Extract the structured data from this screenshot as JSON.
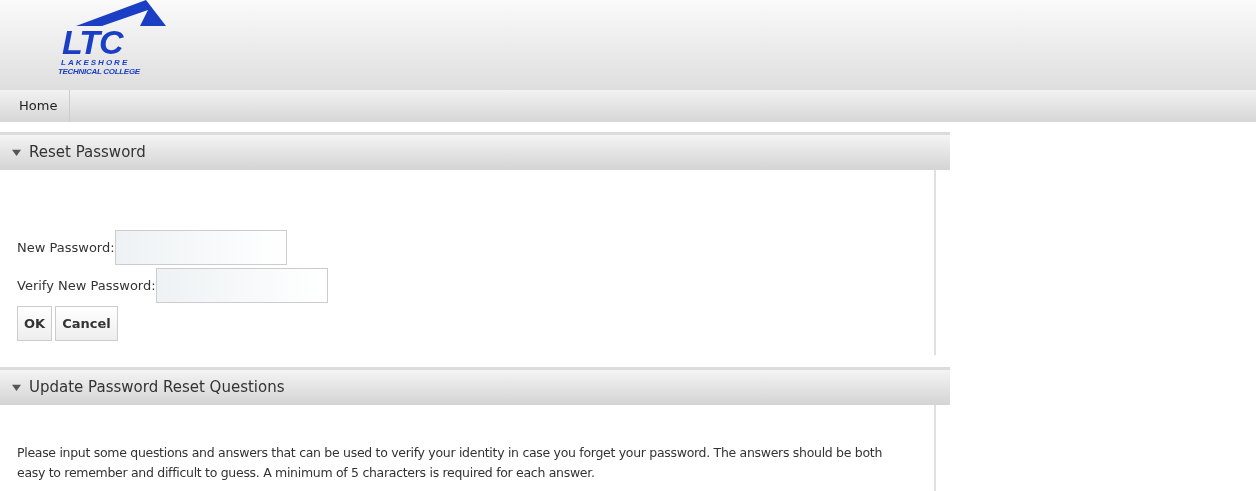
{
  "logo": {
    "mark": "LTC",
    "line_1": "LAKESHORE",
    "line_2": "TECHNICAL COLLEGE"
  },
  "nav": [
    {
      "label": "Home"
    }
  ],
  "panels": [
    {
      "title": "Reset Password",
      "expanded": true,
      "kind": "form",
      "fields": [
        {
          "label": "New Password:"
        },
        {
          "label": "Verify New Password:"
        }
      ],
      "buttons": [
        "OK",
        "Cancel"
      ]
    },
    {
      "title": "Update Password Reset Questions",
      "expanded": true,
      "kind": "text",
      "text": "Please input some questions and answers that can be used to verify your identity in case you forget your password. The answers should be both easy to remember and difficult to guess. A minimum of 5 characters is required for each answer."
    }
  ]
}
